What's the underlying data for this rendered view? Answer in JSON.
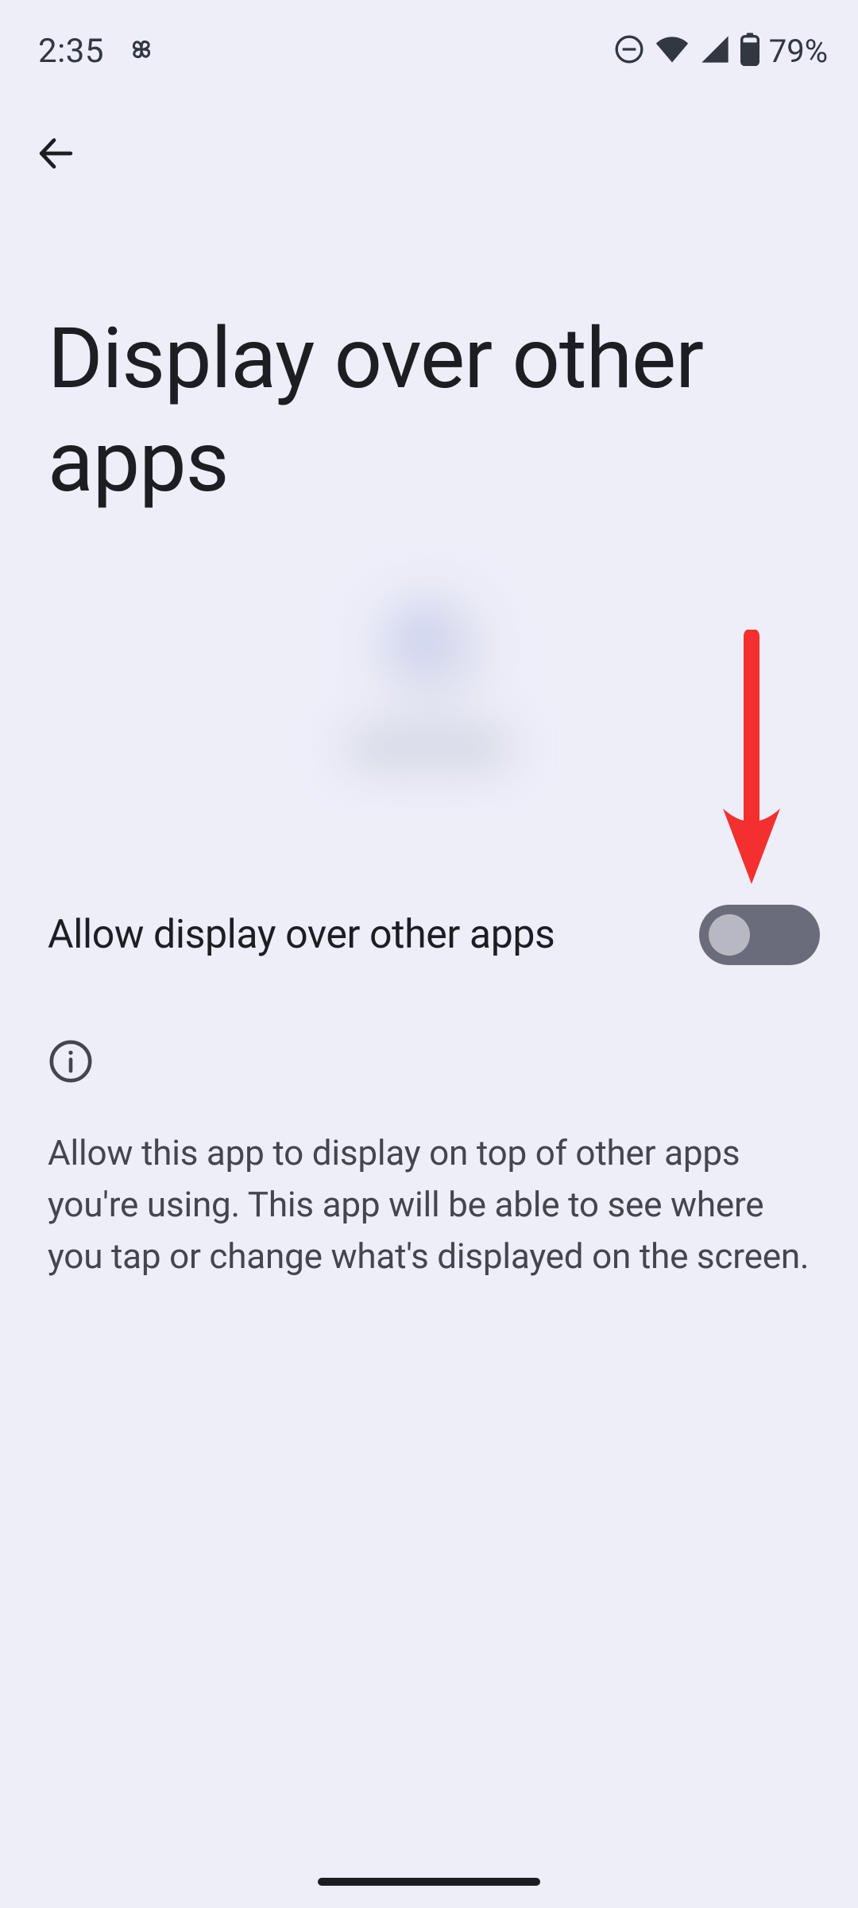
{
  "statusbar": {
    "time": "2:35",
    "battery_pct": "79%"
  },
  "page": {
    "title": "Display over other apps"
  },
  "toggle": {
    "label": "Allow display over other apps",
    "state": "off"
  },
  "info": {
    "description": "Allow this app to display on top of other apps you're using. This app will be able to see where you tap or change what's displayed on the screen."
  },
  "annotation": {
    "arrow_color": "#f3302f"
  }
}
